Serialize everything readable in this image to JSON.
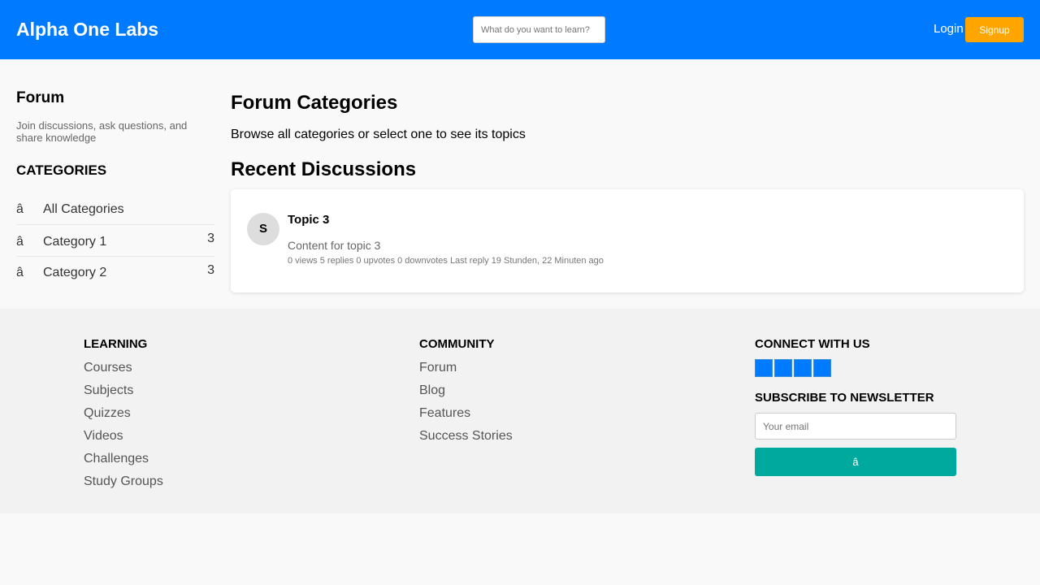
{
  "header": {
    "brand": "Alpha One Labs",
    "search_placeholder": "What do you want to learn?",
    "login_label": "Login",
    "signup_label": "Signup"
  },
  "sidebar": {
    "title": "Forum",
    "description": "Join discussions, ask questions, and share knowledge",
    "categories_heading": "CATEGORIES",
    "categories": [
      {
        "icon": "â",
        "label": "All Categories",
        "count": ""
      },
      {
        "icon": "â",
        "label": "Category 1",
        "count": "3"
      },
      {
        "icon": "â",
        "label": "Category 2",
        "count": "3"
      }
    ]
  },
  "main": {
    "title": "Forum Categories",
    "subtitle": "Browse all categories or select one to see its topics",
    "recent_title": "Recent Discussions",
    "topic": {
      "avatar_letter": "S",
      "title": "Topic 3",
      "content": "Content for topic 3",
      "meta": "0 views 5 replies 0 upvotes 0 downvotes Last reply 19 Stunden, 22 Minuten ago"
    }
  },
  "footer": {
    "learning": {
      "heading": "LEARNING",
      "links": [
        "Courses",
        "Subjects",
        "Quizzes",
        "Videos",
        "Challenges",
        "Study Groups"
      ]
    },
    "community": {
      "heading": "COMMUNITY",
      "links": [
        "Forum",
        "Blog",
        "Features",
        "Success Stories"
      ]
    },
    "connect": {
      "heading": "CONNECT WITH US",
      "social_icons": [
        "social-icon-1",
        "social-icon-2",
        "social-icon-3",
        "social-icon-4"
      ],
      "newsletter_heading": "SUBSCRIBE TO NEWSLETTER",
      "email_placeholder": "Your email",
      "subscribe_label": "â"
    }
  },
  "colors": {
    "header_bg": "#007bff",
    "signup_bg": "#ffa500",
    "subscribe_bg": "#00a99d"
  }
}
